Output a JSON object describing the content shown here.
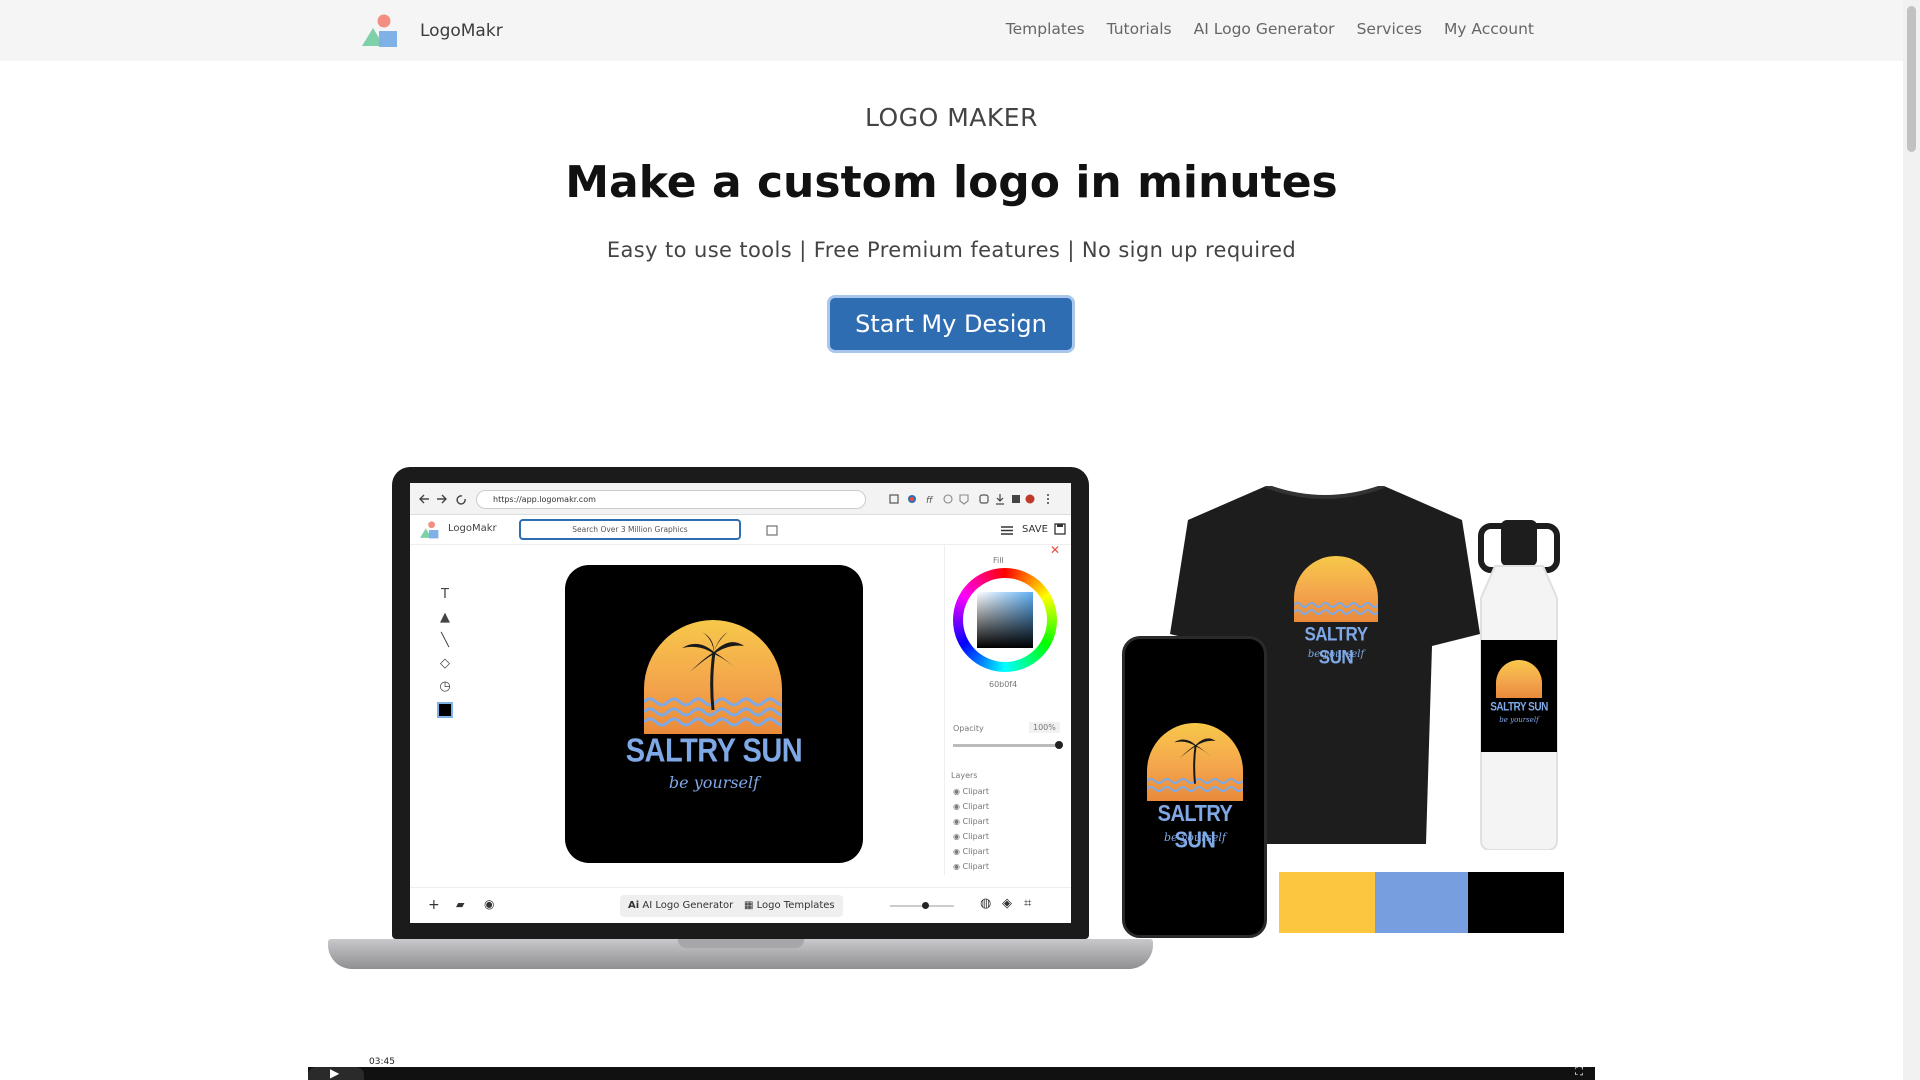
{
  "nav": {
    "brand": "LogoMakr",
    "links": [
      "Templates",
      "Tutorials",
      "AI Logo Generator",
      "Services",
      "My Account"
    ]
  },
  "hero": {
    "eyebrow": "LOGO MAKER",
    "headline": "Make a custom logo in minutes",
    "subline": "Easy to use tools | Free Premium features | No sign up required",
    "cta": "Start My Design"
  },
  "mockup": {
    "url": "https://app.logomakr.com",
    "app_brand": "LogoMakr",
    "search_placeholder": "Search Over 3 Million Graphics",
    "save": "SAVE",
    "fill_label": "Fill",
    "hex_value": "60b0f4",
    "opacity_label": "Opacity",
    "opacity_value": "100%",
    "layers_label": "Layers",
    "layers": [
      "Clipart",
      "Clipart",
      "Clipart",
      "Clipart",
      "Clipart",
      "Clipart"
    ],
    "ai_button": "AI Logo Generator",
    "ai_badge": "Ai",
    "templates_button": "Logo Templates"
  },
  "logo": {
    "title": "SALTRY SUN",
    "tagline": "be yourself"
  },
  "palette": [
    "#fcc63f",
    "#779fe0",
    "#000000"
  ],
  "video": {
    "time": "03:45"
  },
  "icons": [
    "brand-shapes-icon",
    "back-icon",
    "forward-icon",
    "reload-icon",
    "menu-icon",
    "save-icon",
    "text-tool-icon",
    "shape-tool-icon",
    "line-tool-icon",
    "eraser-tool-icon",
    "history-tool-icon",
    "close-icon",
    "eye-icon",
    "plus-icon",
    "play-icon",
    "fullscreen-icon"
  ]
}
